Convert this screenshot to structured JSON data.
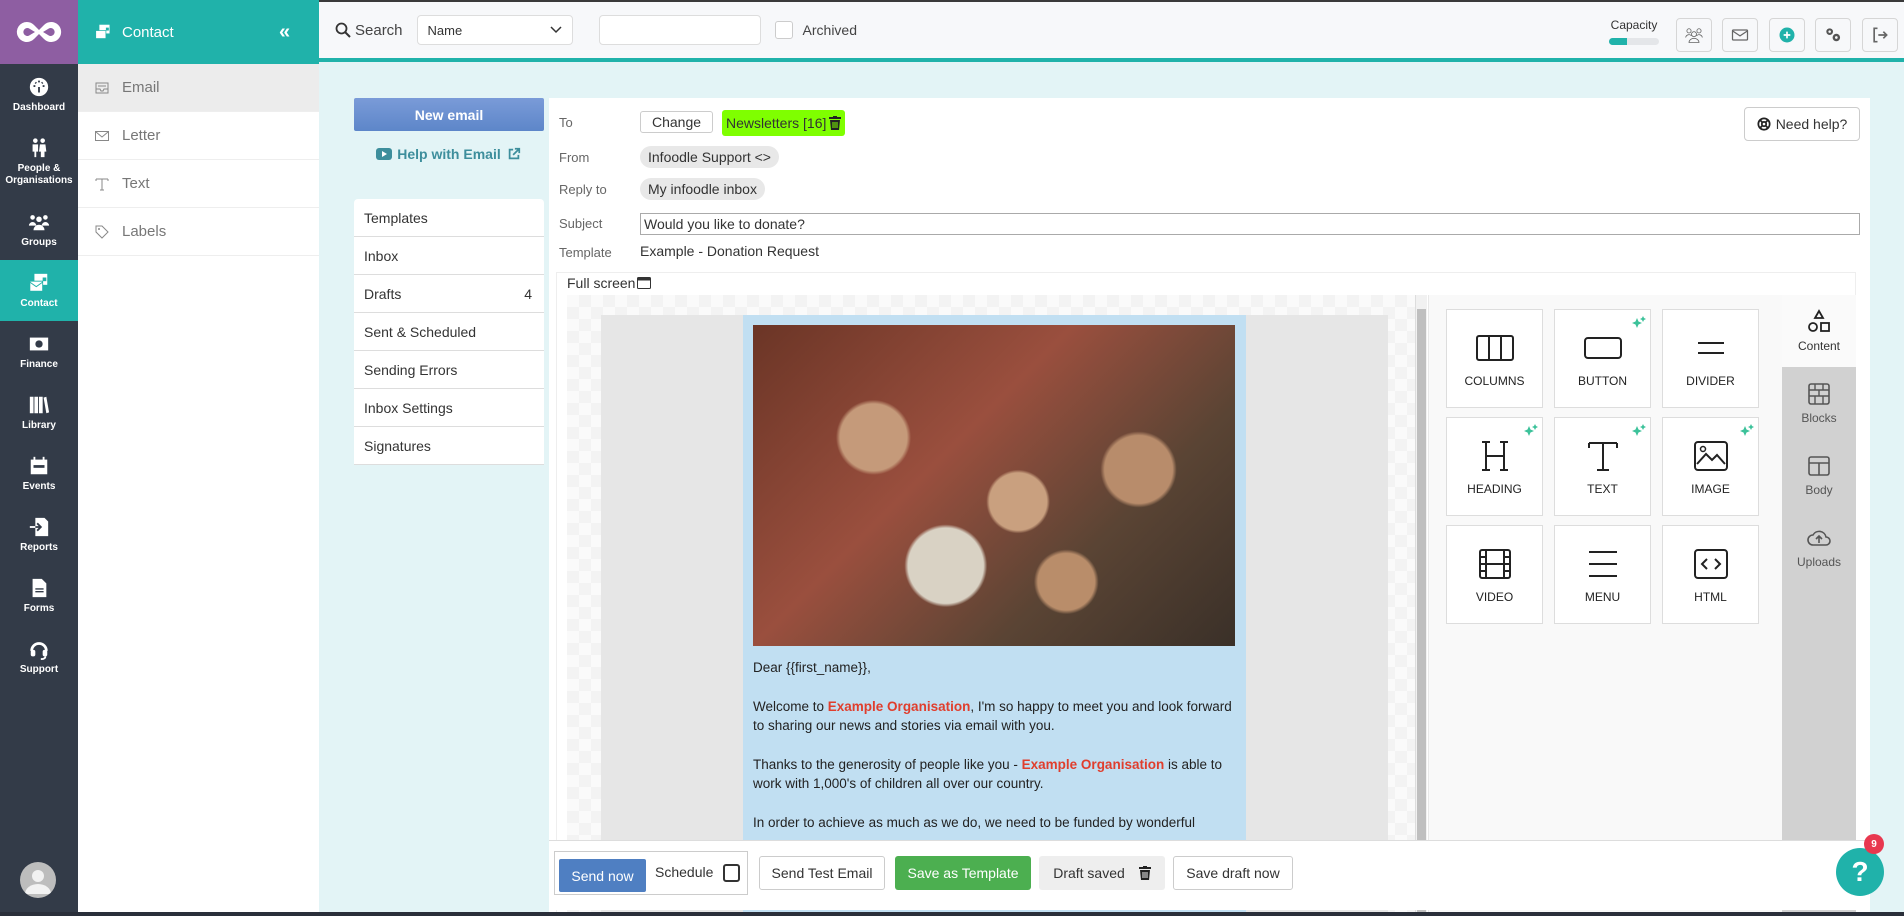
{
  "rail": {
    "items": [
      {
        "label": "Dashboard",
        "icon": "dashboard-icon"
      },
      {
        "label": "People & Organisations",
        "icon": "people-icon"
      },
      {
        "label": "Groups",
        "icon": "groups-icon"
      },
      {
        "label": "Contact",
        "icon": "contact-icon",
        "active": true
      },
      {
        "label": "Finance",
        "icon": "finance-icon"
      },
      {
        "label": "Library",
        "icon": "library-icon"
      },
      {
        "label": "Events",
        "icon": "events-icon"
      },
      {
        "label": "Reports",
        "icon": "reports-icon"
      },
      {
        "label": "Forms",
        "icon": "forms-icon"
      },
      {
        "label": "Support",
        "icon": "support-icon"
      }
    ]
  },
  "subsidebar": {
    "title": "Contact",
    "collapse_glyph": "«",
    "items": [
      {
        "label": "Email",
        "active": true
      },
      {
        "label": "Letter"
      },
      {
        "label": "Text"
      },
      {
        "label": "Labels"
      }
    ]
  },
  "topbar": {
    "search_label": "Search",
    "search_field": "Name",
    "search_value": "",
    "archived_label": "Archived",
    "archived_checked": false,
    "capacity_label": "Capacity",
    "capacity_fraction": 0.35
  },
  "email_nav": {
    "new_email": "New email",
    "help": "Help with Email",
    "items": [
      {
        "label": "Templates",
        "count": ""
      },
      {
        "label": "Inbox",
        "count": ""
      },
      {
        "label": "Drafts",
        "count": "4"
      },
      {
        "label": "Sent & Scheduled",
        "count": ""
      },
      {
        "label": "Sending Errors",
        "count": ""
      },
      {
        "label": "Inbox Settings",
        "count": ""
      },
      {
        "label": "Signatures",
        "count": ""
      }
    ]
  },
  "compose": {
    "to_label": "To",
    "change": "Change",
    "recipient": "Newsletters [16]",
    "from_label": "From",
    "from_value": "Infoodle Support <>",
    "reply_label": "Reply to",
    "reply_value": "My infoodle inbox",
    "subject_label": "Subject",
    "subject_value": "Would you like to donate?",
    "template_label": "Template",
    "template_value": "Example - Donation Request",
    "need_help": "Need help?",
    "full_screen": "Full screen"
  },
  "email_body": {
    "greeting": "Dear {{first_name}},",
    "p1_a": "Welcome to ",
    "org": "Example Organisation",
    "p1_b": ", I'm so happy to meet you and look forward to sharing our news and stories via email with you.",
    "p2_a": "Thanks to the generosity of people like you - ",
    "p2_b": " is able to work with 1,000's of children all over our country.",
    "p3": "In order to achieve as much as we do, we need to be funded by wonderful"
  },
  "tools": [
    {
      "label": "COLUMNS",
      "ai": false
    },
    {
      "label": "BUTTON",
      "ai": true
    },
    {
      "label": "DIVIDER",
      "ai": false
    },
    {
      "label": "HEADING",
      "ai": true
    },
    {
      "label": "TEXT",
      "ai": true
    },
    {
      "label": "IMAGE",
      "ai": true
    },
    {
      "label": "VIDEO",
      "ai": false
    },
    {
      "label": "MENU",
      "ai": false
    },
    {
      "label": "HTML",
      "ai": false
    }
  ],
  "editor_tabs": [
    {
      "label": "Content",
      "active": true
    },
    {
      "label": "Blocks"
    },
    {
      "label": "Body"
    },
    {
      "label": "Uploads"
    }
  ],
  "actions": {
    "send_now": "Send now",
    "schedule": "Schedule",
    "send_test": "Send Test Email",
    "save_template": "Save as Template",
    "draft_saved": "Draft saved",
    "save_draft": "Save draft now"
  },
  "help_fab": {
    "glyph": "?",
    "badge": "9"
  }
}
